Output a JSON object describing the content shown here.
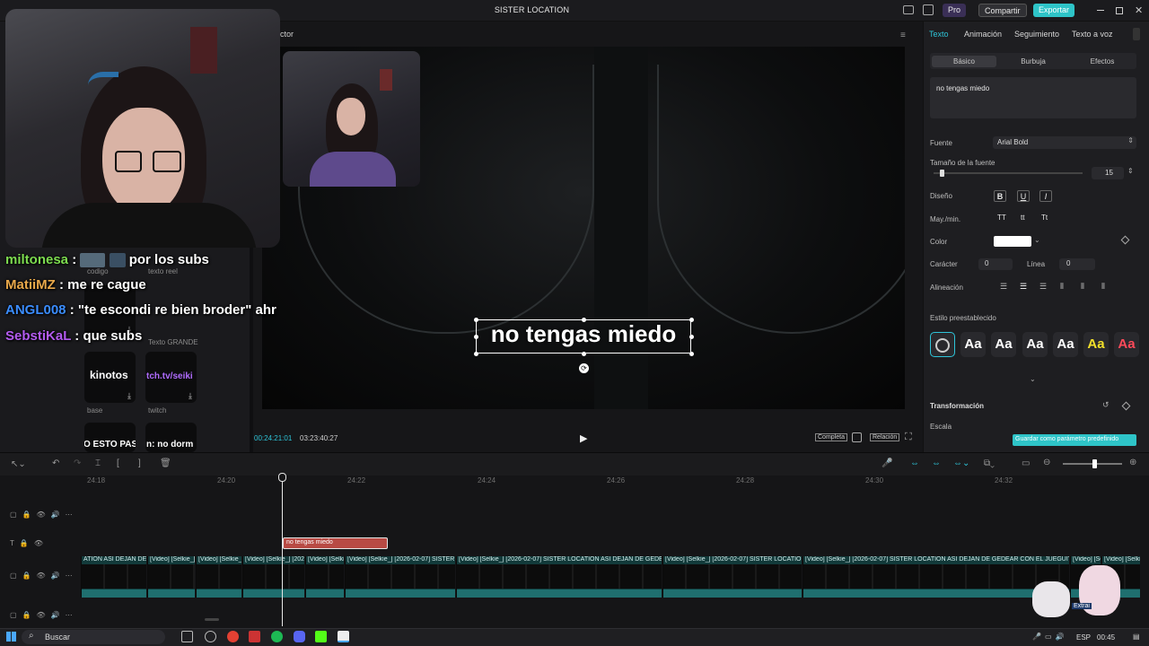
{
  "window": {
    "title": "SISTER LOCATION",
    "pro_label": "Pro",
    "share_label": "Compartir",
    "export_label": "Exportar"
  },
  "left_panel": {
    "chat": [
      {
        "user": "miltonesa",
        "user_color": "#7ddc4f",
        "message": "por los subs"
      },
      {
        "user": "MatiiMZ",
        "user_color": "#e8a84a",
        "message": "me re cague"
      },
      {
        "user": "ANGL008",
        "user_color": "#3b8dff",
        "message": "\"te escondi re bien broder\" ahr"
      },
      {
        "user": "SebstiKaL",
        "user_color": "#b35bf0",
        "message": "que subs"
      }
    ],
    "assets": [
      {
        "caption": "codigo",
        "card_text": ""
      },
      {
        "caption": "texto reel",
        "card_text": ""
      },
      {
        "caption": "Texto GRANDE",
        "card_text": ""
      },
      {
        "caption": "base",
        "card_text": "kinotos"
      },
      {
        "caption": "twitch",
        "card_text": "tch.tv/seiki"
      },
      {
        "caption": "",
        "card_text": "O ESTO PAS"
      },
      {
        "caption": "",
        "card_text": "n: no dorm"
      }
    ]
  },
  "player": {
    "title_fragment": "ctor",
    "caption_text": "no tengas miedo",
    "current_time": "00:24:21:01",
    "total_time": "03:23:40:27",
    "complete_label": "Completa",
    "ratio_label": "Relación"
  },
  "inspector": {
    "tabs": [
      "Texto",
      "Animación",
      "Seguimiento",
      "Texto a voz"
    ],
    "subtabs": [
      "Básico",
      "Burbuja",
      "Efectos"
    ],
    "text_value": "no tengas miedo",
    "font_label": "Fuente",
    "font_value": "Arial Bold",
    "font_size_label": "Tamaño de la fuente",
    "font_size_value": "15",
    "font_size_fraction": 0.04,
    "design_label": "Diseño",
    "case_label": "May./min.",
    "case_options": [
      "TT",
      "tt",
      "Tt"
    ],
    "color_label": "Color",
    "text_color": "#ffffff",
    "char_label": "Carácter",
    "char_value": "0",
    "line_label": "Línea",
    "line_value": "0",
    "align_label": "Alineación",
    "preset_label": "Estilo preestablecido",
    "transform_label": "Transformación",
    "scale_label": "Escala",
    "save_preset_label": "Guardar como parámetro predefinido",
    "preset_tiles": [
      {
        "text": "",
        "color": "#cccccc"
      },
      {
        "text": "Aa",
        "color": "#ffffff"
      },
      {
        "text": "Aa",
        "color": "#ffffff"
      },
      {
        "text": "Aa",
        "color": "#ffffff"
      },
      {
        "text": "Aa",
        "color": "#ffffff"
      },
      {
        "text": "Aa",
        "color": "#f2e02a"
      },
      {
        "text": "Aa",
        "color": "#ff4a5a"
      }
    ]
  },
  "timeline": {
    "ticks": [
      "24:18",
      "24:20",
      "24:22",
      "24:24",
      "24:26",
      "24:28",
      "24:30",
      "24:32"
    ],
    "text_clip": "no tengas miedo",
    "video_clips": [
      "ATION ASI DEJAN DE G",
      "[Video] [Selkie_]",
      "[Video] [Selkie_]",
      "[Video] [Selkie_] [2026-02-07]",
      "[Video] [Selkie_] [2",
      "[Video] [Selkie_] [2026-02-07] SISTER",
      "[Video] [Selkie_] [2026-02-07] SISTER LOCATION ASI DEJAN DE GEDEAR",
      "[Video] [Selkie_] [2026-02-07] SISTER LOCATION",
      "[Video] [Selkie_] [2026-02-07] SISTER LOCATION ASI DEJAN DE GEDEAR CON EL JUEGUITO",
      "[Video] [Selkie_]",
      "[Video] [Selkie_]"
    ],
    "extract_label": "Extrai"
  },
  "taskbar": {
    "search_label": "Buscar",
    "language": "ESP",
    "time": "00:45"
  },
  "colors": {
    "accent": "#1fc8d6",
    "text_clip": "#b84a44",
    "export_btn": "#2ec4c8"
  }
}
